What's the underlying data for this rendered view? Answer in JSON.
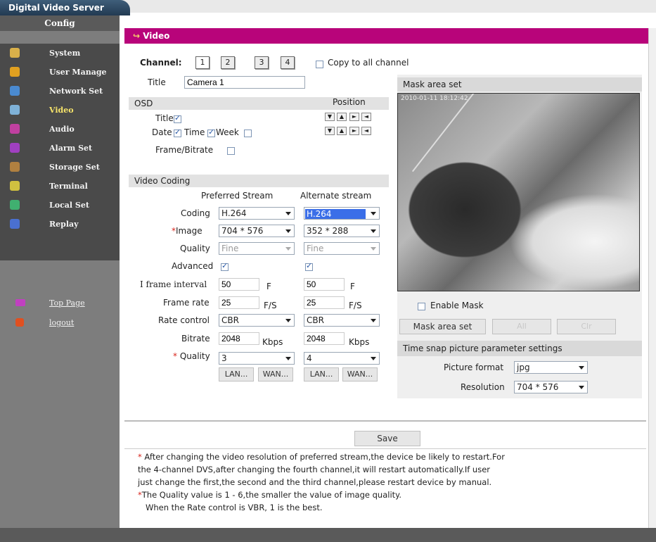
{
  "app": {
    "title": "Digital Video Server"
  },
  "sidebar": {
    "header": "Config",
    "items": [
      {
        "label": "System",
        "icon": "system-icon",
        "color": "#d9b04a"
      },
      {
        "label": "User Manage",
        "icon": "users-icon",
        "color": "#e0a020"
      },
      {
        "label": "Network Set",
        "icon": "network-icon",
        "color": "#4a8ad0"
      },
      {
        "label": "Video",
        "icon": "video-icon",
        "color": "#7fb2d8"
      },
      {
        "label": "Audio",
        "icon": "audio-icon",
        "color": "#c040a0"
      },
      {
        "label": "Alarm Set",
        "icon": "alarm-icon",
        "color": "#a040c0"
      },
      {
        "label": "Storage Set",
        "icon": "storage-icon",
        "color": "#b08040"
      },
      {
        "label": "Terminal",
        "icon": "terminal-icon",
        "color": "#d0c040"
      },
      {
        "label": "Local Set",
        "icon": "local-set-icon",
        "color": "#40b070"
      },
      {
        "label": "Replay",
        "icon": "replay-icon",
        "color": "#4a70d0"
      }
    ],
    "links": [
      {
        "label": "Top Page",
        "icon": "top-page-icon"
      },
      {
        "label": "logout",
        "icon": "logout-icon"
      }
    ]
  },
  "page": {
    "title": "Video"
  },
  "channel": {
    "label": "Channel:",
    "buttons": [
      "1",
      "2",
      "3",
      "4"
    ],
    "copy_label": "Copy to all channel"
  },
  "title_field": {
    "label": "Title",
    "value": "Camera 1"
  },
  "osd": {
    "header": "OSD",
    "position_label": "Position",
    "title_label": "Title",
    "date_label": "Date",
    "time_label": "Time",
    "week_label": "Week",
    "frame_label": "Frame/Bitrate",
    "arrows": [
      "▼",
      "▲",
      "►",
      "◄"
    ]
  },
  "coding": {
    "header": "Video Coding",
    "preferred_label": "Preferred Stream",
    "alternate_label": "Alternate stream",
    "rows": {
      "coding": {
        "label": "Coding",
        "pref": "H.264",
        "alt": "H.264"
      },
      "image": {
        "mark": "*",
        "label": "Image",
        "pref": "704 * 576",
        "alt": "352 * 288"
      },
      "quality": {
        "label": "Quality",
        "pref": "Fine",
        "alt": "Fine"
      },
      "advanced": {
        "label": "Advanced"
      },
      "iframe": {
        "label": "I frame interval",
        "pref": "50",
        "alt": "50",
        "unit": "F"
      },
      "framerate": {
        "label": "Frame rate",
        "pref": "25",
        "alt": "25",
        "unit": "F/S"
      },
      "ratecontrol": {
        "label": "Rate control",
        "pref": "CBR",
        "alt": "CBR"
      },
      "bitrate": {
        "label": "Bitrate",
        "pref": "2048",
        "alt": "2048",
        "unit": "Kbps"
      },
      "quality2": {
        "mark": "*",
        "label": "Quality",
        "pref": "3",
        "alt": "4"
      }
    },
    "lan_label": "LAN...",
    "wan_label": "WAN..."
  },
  "mask": {
    "header": "Mask area set",
    "timestamp": "2010-01-11 18:12:42",
    "enable_label": "Enable Mask",
    "set_btn": "Mask area set",
    "all_btn": "All",
    "clr_btn": "Clr"
  },
  "snap": {
    "header": "Time snap picture parameter settings",
    "format_label": "Picture format",
    "format_value": "jpg",
    "resolution_label": "Resolution",
    "resolution_value": "704 * 576"
  },
  "save_label": "Save",
  "notes": {
    "mark": "*",
    "line1": " After changing the video resolution of preferred stream,the device be likely to restart.For",
    "line2": "the 4-channel DVS,after changing the fourth channel,it will restart automatically.If user",
    "line3": "just change the first,the second and the third channel,please restart device by manual.",
    "line4": "The Quality value is 1 - 6,the smaller the value of image quality.",
    "line5": "   When the Rate control is VBR, 1 is the best."
  }
}
